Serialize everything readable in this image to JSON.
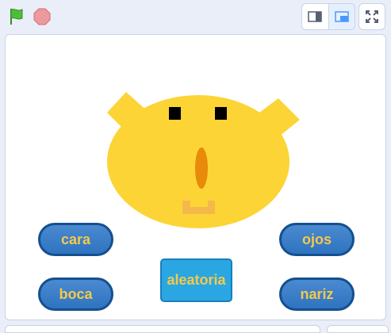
{
  "toolbar": {
    "green_flag_icon": "green-flag-icon",
    "stop_icon": "stop-icon",
    "small_stage_icon": "small-stage-icon",
    "normal_stage_icon": "normal-stage-icon",
    "fullscreen_icon": "fullscreen-icon"
  },
  "colors": {
    "face": "#fdd436",
    "nose": "#e88a0a",
    "mouth": "#f5b84a",
    "eyes": "#000000",
    "button_text": "#f6c94a",
    "button_blue": "#2f73c0"
  },
  "stage": {
    "buttons": {
      "cara": "cara",
      "ojos": "ojos",
      "boca": "boca",
      "nariz": "nariz",
      "aleatoria": "aleatoria"
    }
  }
}
